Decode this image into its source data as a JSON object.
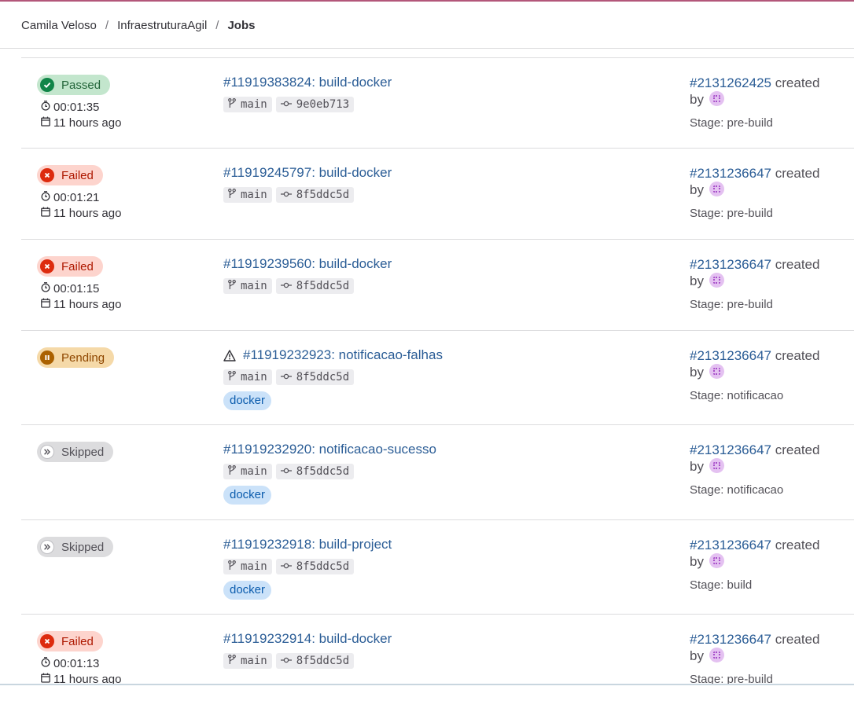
{
  "breadcrumb": {
    "items": [
      "Camila Veloso",
      "InfraestruturaAgil"
    ],
    "current": "Jobs",
    "separator": "/"
  },
  "colors": {
    "passed": "#108548",
    "failed": "#dd2b0e",
    "pending": "#ab6100",
    "skipped": "#737278",
    "link": "#2b5d96"
  },
  "jobs": [
    {
      "status": "passed",
      "status_label": "Passed",
      "duration": "00:01:35",
      "finished": "11 hours ago",
      "title": "#11919383824: build-docker",
      "warning": false,
      "branch": "main",
      "commit": "9e0eb713",
      "tag": "",
      "pipeline": "#2131262425",
      "created": "created",
      "by": "by",
      "stage": "Stage: pre-build"
    },
    {
      "status": "failed",
      "status_label": "Failed",
      "duration": "00:01:21",
      "finished": "11 hours ago",
      "title": "#11919245797: build-docker",
      "warning": false,
      "branch": "main",
      "commit": "8f5ddc5d",
      "tag": "",
      "pipeline": "#2131236647",
      "created": "created",
      "by": "by",
      "stage": "Stage: pre-build"
    },
    {
      "status": "failed",
      "status_label": "Failed",
      "duration": "00:01:15",
      "finished": "11 hours ago",
      "title": "#11919239560: build-docker",
      "warning": false,
      "branch": "main",
      "commit": "8f5ddc5d",
      "tag": "",
      "pipeline": "#2131236647",
      "created": "created",
      "by": "by",
      "stage": "Stage: pre-build"
    },
    {
      "status": "pending",
      "status_label": "Pending",
      "duration": "",
      "finished": "",
      "title": "#11919232923: notificacao-falhas",
      "warning": true,
      "branch": "main",
      "commit": "8f5ddc5d",
      "tag": "docker",
      "pipeline": "#2131236647",
      "created": "created",
      "by": "by",
      "stage": "Stage: notificacao"
    },
    {
      "status": "skipped",
      "status_label": "Skipped",
      "duration": "",
      "finished": "",
      "title": "#11919232920: notificacao-sucesso",
      "warning": false,
      "branch": "main",
      "commit": "8f5ddc5d",
      "tag": "docker",
      "pipeline": "#2131236647",
      "created": "created",
      "by": "by",
      "stage": "Stage: notificacao"
    },
    {
      "status": "skipped",
      "status_label": "Skipped",
      "duration": "",
      "finished": "",
      "title": "#11919232918: build-project",
      "warning": false,
      "branch": "main",
      "commit": "8f5ddc5d",
      "tag": "docker",
      "pipeline": "#2131236647",
      "created": "created",
      "by": "by",
      "stage": "Stage: build"
    },
    {
      "status": "failed",
      "status_label": "Failed",
      "duration": "00:01:13",
      "finished": "11 hours ago",
      "title": "#11919232914: build-docker",
      "warning": false,
      "branch": "main",
      "commit": "8f5ddc5d",
      "tag": "",
      "pipeline": "#2131236647",
      "created": "created",
      "by": "by",
      "stage": "Stage: pre-build"
    }
  ]
}
